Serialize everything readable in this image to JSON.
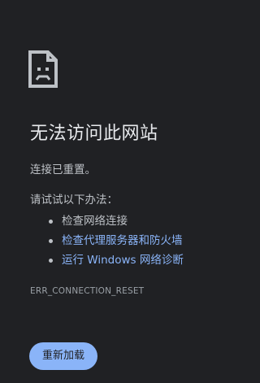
{
  "error_page": {
    "icon": "sad-document-icon",
    "title": "无法访问此网站",
    "subtitle": "连接已重置。",
    "suggestions_heading": "请试试以下办法：",
    "suggestions": [
      {
        "label": "检查网络连接",
        "is_link": false
      },
      {
        "label": "检查代理服务器和防火墙",
        "is_link": true
      },
      {
        "label": "运行 Windows 网络诊断",
        "is_link": true
      }
    ],
    "error_code": "ERR_CONNECTION_RESET",
    "reload_button_label": "重新加载"
  },
  "colors": {
    "background": "#202124",
    "title_text": "#e8eaed",
    "body_text": "#bdc1c6",
    "link": "#8ab4f8",
    "button_bg": "#8ab4f8",
    "button_text": "#202124",
    "error_code_text": "#9aa0a6"
  }
}
